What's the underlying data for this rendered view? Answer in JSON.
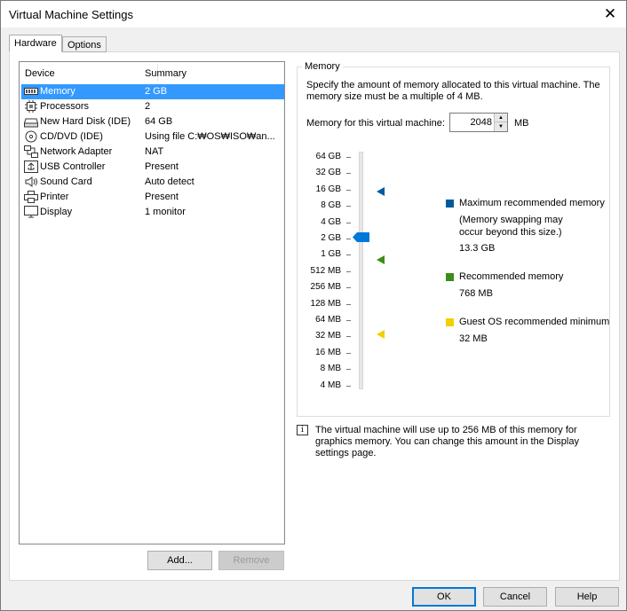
{
  "window": {
    "title": "Virtual Machine Settings"
  },
  "tabs": [
    {
      "label": "Hardware"
    },
    {
      "label": "Options"
    }
  ],
  "device_list": {
    "columns": {
      "device": "Device",
      "summary": "Summary"
    },
    "rows": [
      {
        "icon": "memory-icon",
        "name": "Memory",
        "summary": "2 GB",
        "selected": true
      },
      {
        "icon": "processor-icon",
        "name": "Processors",
        "summary": "2"
      },
      {
        "icon": "hard-disk-icon",
        "name": "New Hard Disk (IDE)",
        "summary": "64 GB"
      },
      {
        "icon": "cd-dvd-icon",
        "name": "CD/DVD (IDE)",
        "summary": "Using file C:₩OS₩ISO₩an..."
      },
      {
        "icon": "network-adapter-icon",
        "name": "Network Adapter",
        "summary": "NAT"
      },
      {
        "icon": "usb-icon",
        "name": "USB Controller",
        "summary": "Present"
      },
      {
        "icon": "speaker-icon",
        "name": "Sound Card",
        "summary": "Auto detect"
      },
      {
        "icon": "printer-icon",
        "name": "Printer",
        "summary": "Present"
      },
      {
        "icon": "monitor-icon",
        "name": "Display",
        "summary": "1 monitor"
      }
    ],
    "add_label": "Add...",
    "remove_label": "Remove"
  },
  "memory": {
    "group_title": "Memory",
    "description": "Specify the amount of memory allocated to this virtual machine. The memory size must be a multiple of 4 MB.",
    "field_label": "Memory for this virtual machine:",
    "value": "2048",
    "unit": "MB",
    "scale": [
      "64 GB",
      "32 GB",
      "16 GB",
      "8 GB",
      "4 GB",
      "2 GB",
      "1 GB",
      "512 MB",
      "256 MB",
      "128 MB",
      "64 MB",
      "32 MB",
      "16 MB",
      "8 MB",
      "4 MB"
    ],
    "current_value": "2 GB",
    "legend": {
      "max": {
        "label": "Maximum recommended memory",
        "note": "(Memory swapping may occur beyond this size.)",
        "value": "13.3 GB",
        "color": "#005a9e"
      },
      "recommended": {
        "label": "Recommended memory",
        "value": "768 MB",
        "color": "#3c8c1a"
      },
      "guest_min": {
        "label": "Guest OS recommended minimum",
        "value": "32 MB",
        "color": "#f0d000"
      }
    },
    "slider_color": "#0078d7"
  },
  "info_note": "The virtual machine will use up to 256 MB of this memory for graphics memory. You can change this amount in the Display settings page.",
  "footer": {
    "ok": "OK",
    "cancel": "Cancel",
    "help": "Help"
  }
}
